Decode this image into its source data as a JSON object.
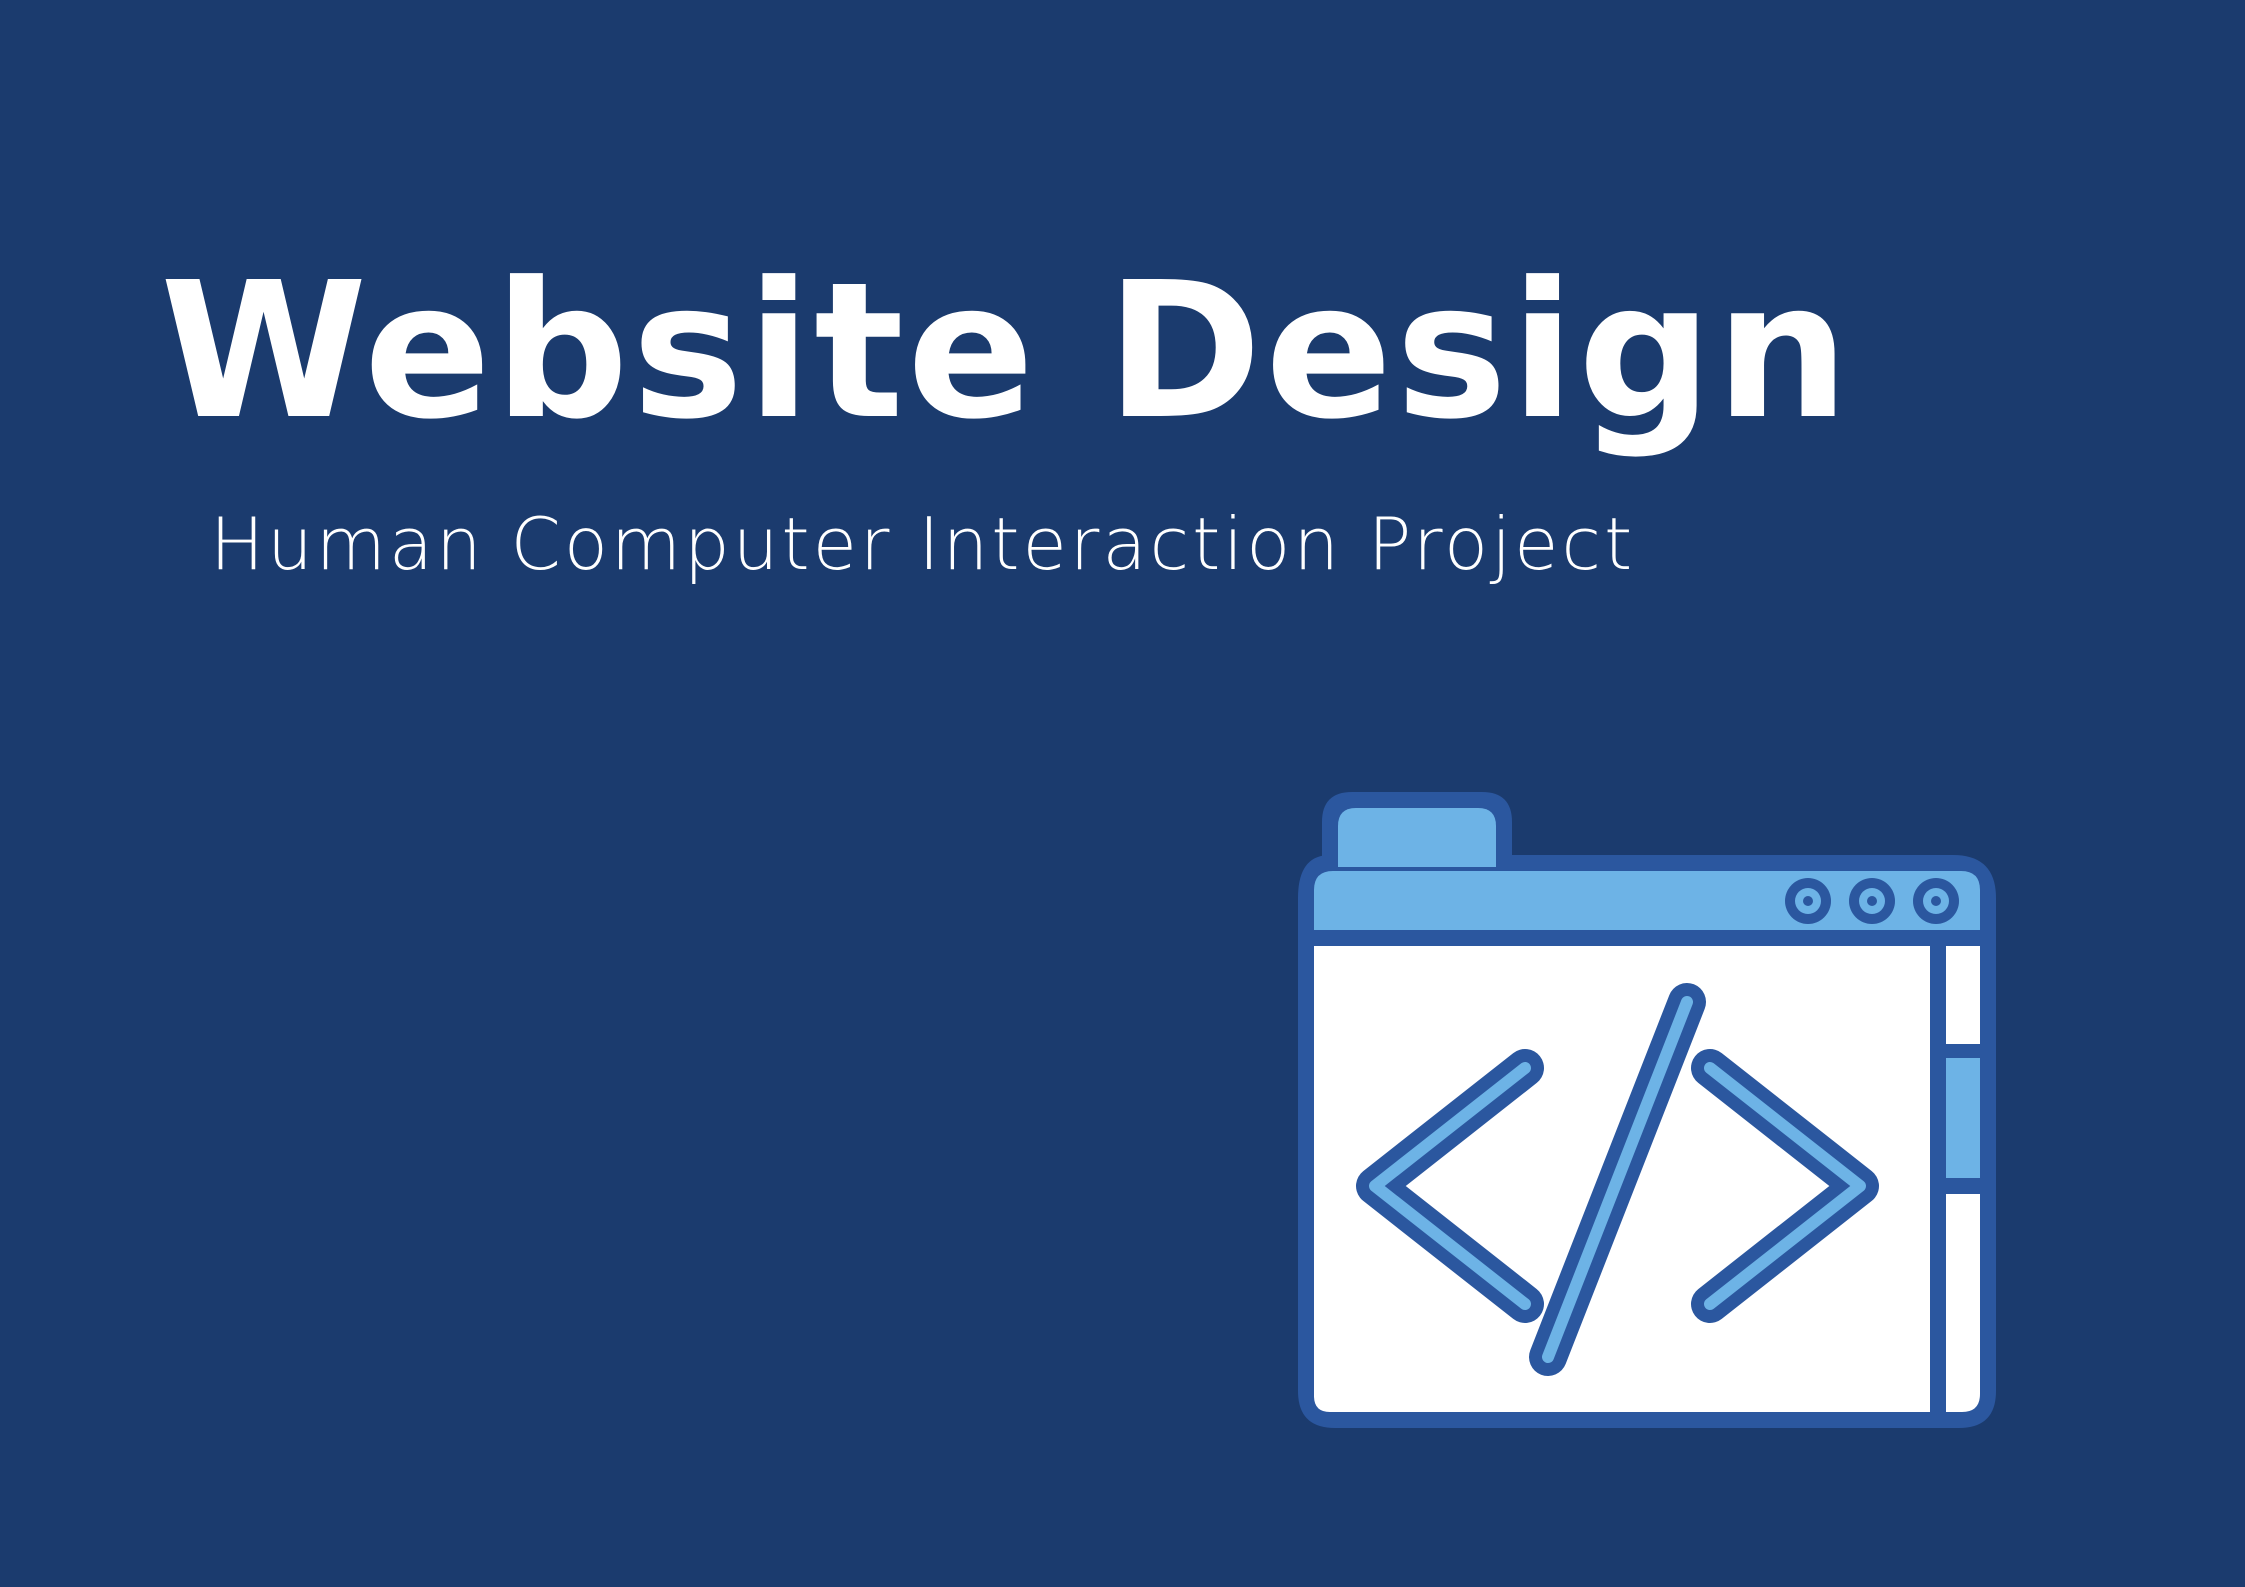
{
  "heading": {
    "title": "Website Design",
    "subtitle": "Human Computer Interaction Project"
  },
  "illustration": {
    "name": "browser-code-window",
    "icons": [
      "browser-window-icon",
      "code-brackets-icon"
    ],
    "window_dots": 3
  },
  "colors": {
    "background": "#1b3b6e",
    "text": "#ffffff",
    "outline": "#2b579f",
    "accent": "#6db3e6",
    "window_body": "#ffffff"
  }
}
